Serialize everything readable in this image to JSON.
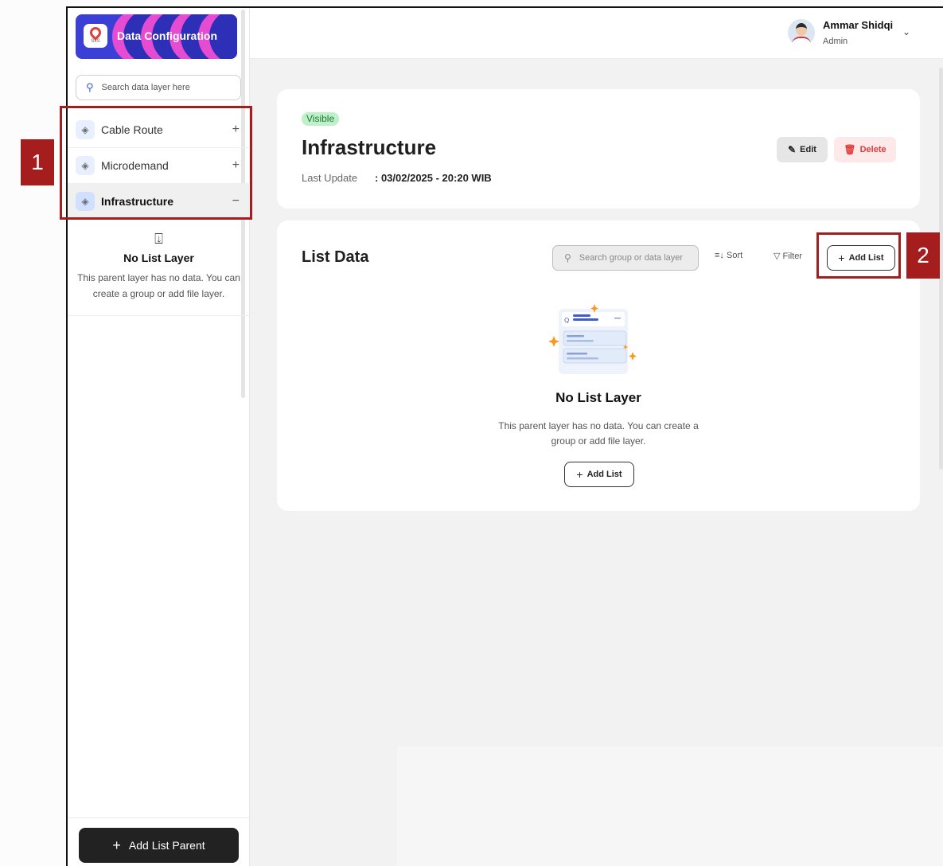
{
  "sidebar": {
    "app_title": "Data Configuration",
    "logo_sub": "SIIS",
    "search": {
      "placeholder": "Search data layer here"
    },
    "items": [
      {
        "label": "Cable Route",
        "toggle": "+"
      },
      {
        "label": "Microdemand",
        "toggle": "+"
      },
      {
        "label": "Infrastructure",
        "toggle": "−"
      }
    ],
    "empty": {
      "title": "No List Layer",
      "description": "This parent layer has no data. You can create a group or add file layer."
    },
    "add_parent_label": "Add List Parent"
  },
  "header": {
    "user_name": "Ammar Shidqi",
    "user_role": "Admin"
  },
  "detail": {
    "status": "Visible",
    "title": "Infrastructure",
    "last_update_label": "Last Update",
    "last_update_value": ": 03/02/2025 - 20:20 WIB",
    "edit_label": "Edit",
    "delete_label": "Delete"
  },
  "list": {
    "title": "List Data",
    "search_placeholder": "Search group or data layer",
    "sort_label": "Sort",
    "filter_label": "Filter",
    "add_label": "Add List",
    "empty_title": "No List Layer",
    "empty_description": "This parent layer has no data. You can create a group or add file layer.",
    "empty_add_label": "Add List"
  },
  "annotations": {
    "badge_1": "1",
    "badge_2": "2",
    "highlight_color": "#a51d1d"
  },
  "colors": {
    "brand_blue": "#3b3fd6",
    "brand_pink": "#e64cd1",
    "visible_green": "#1c7a35",
    "delete_red": "#e03a3a"
  }
}
